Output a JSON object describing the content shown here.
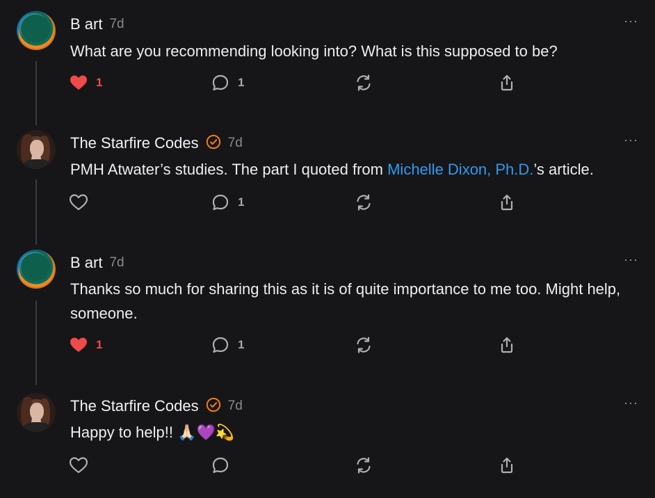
{
  "comments": [
    {
      "author": "B art",
      "time": "7d",
      "more": "···",
      "text": "What are you recommending looking into? What is this supposed to be?",
      "likes": "1",
      "liked": true,
      "replies": "1"
    },
    {
      "author": "The Starfire Codes",
      "time": "7d",
      "more": "···",
      "text_before": "PMH Atwater’s studies. The part I quoted from ",
      "text_link": "Michelle Dixon, Ph.D.",
      "text_after": "’s article.",
      "likes": "",
      "liked": false,
      "replies": "1"
    },
    {
      "author": "B art",
      "time": "7d",
      "more": "···",
      "text": "Thanks so much for sharing this as it is of quite importance to me too. Might help, someone.",
      "likes": "1",
      "liked": true,
      "replies": "1"
    },
    {
      "author": "The Starfire Codes",
      "time": "7d",
      "more": "···",
      "text": "Happy to help!! 🙏🏻💜💫",
      "likes": "",
      "liked": false,
      "replies": ""
    }
  ],
  "colors": {
    "background": "#161618",
    "like_active": "#ef4a4a",
    "link": "#2e9bf0",
    "verified": "#f07c1c"
  },
  "icons": [
    "heart-icon",
    "comment-icon",
    "restack-icon",
    "share-icon",
    "verified-badge-icon",
    "more-icon"
  ]
}
